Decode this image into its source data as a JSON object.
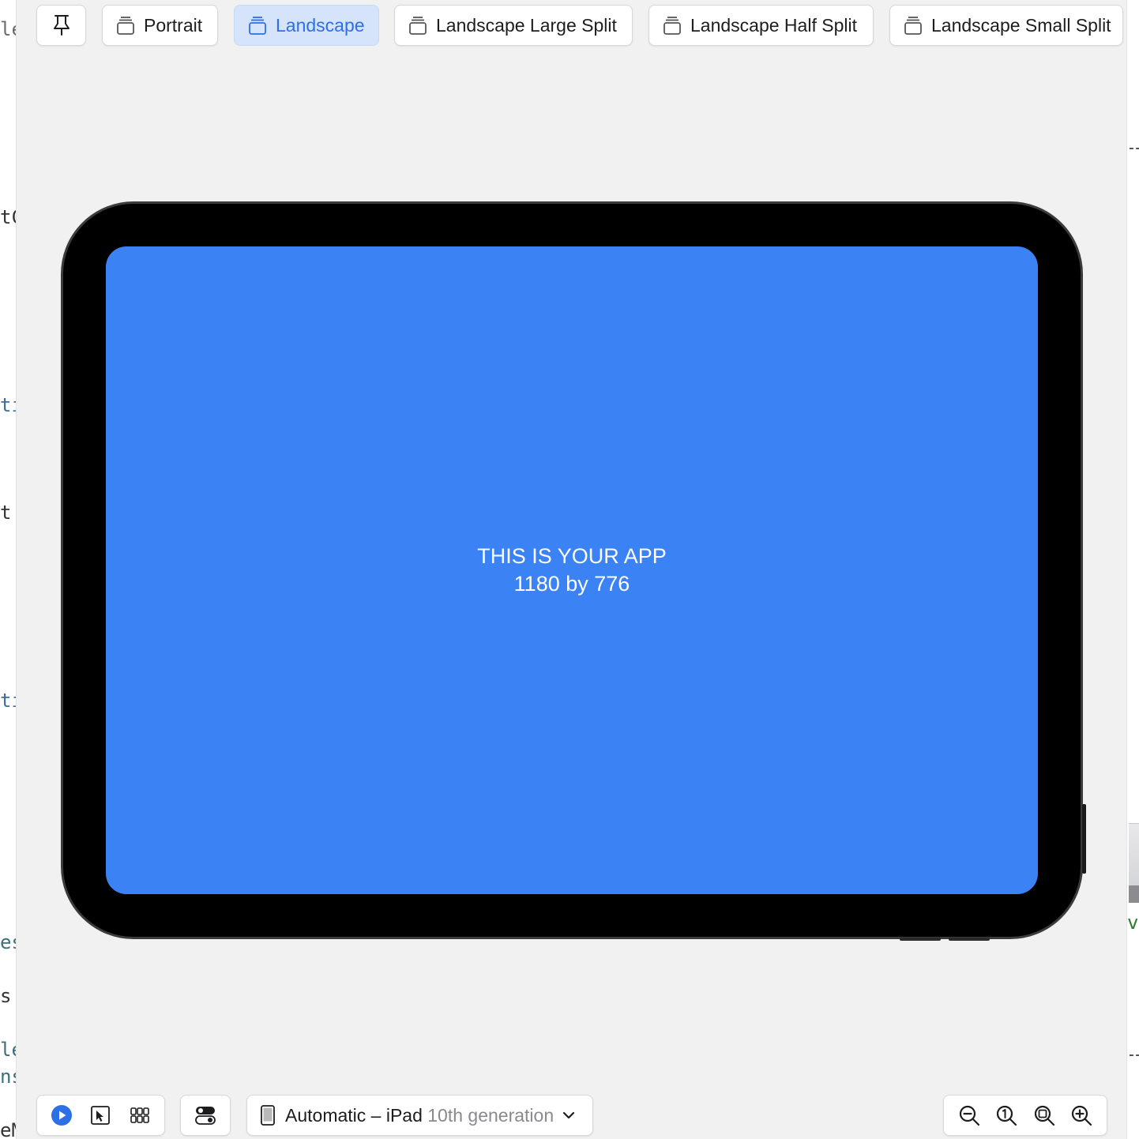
{
  "toolbar": {
    "pin_label": "",
    "orientations": [
      {
        "label": "Portrait",
        "selected": false
      },
      {
        "label": "Landscape",
        "selected": true
      },
      {
        "label": "Landscape Large Split",
        "selected": false
      },
      {
        "label": "Landscape Half Split",
        "selected": false
      },
      {
        "label": "Landscape Small Split",
        "selected": false
      }
    ]
  },
  "preview": {
    "line1": "THIS IS YOUR APP",
    "line2": "1180 by 776",
    "screen_color": "#3b82f5",
    "bezel_color": "#000000"
  },
  "device_selector": {
    "prefix": "Automatic – iPad",
    "model": "10th generation"
  },
  "bottom_controls": {
    "live_icon": "play-circle-icon",
    "select_icon": "cursor-select-icon",
    "variants_icon": "grid-variants-icon",
    "settings_icon": "toggle-settings-icon"
  },
  "zoom_controls": [
    "zoom-out-icon",
    "zoom-actual-size-icon",
    "zoom-to-fit-icon",
    "zoom-in-icon"
  ],
  "editor_fragments_left": [
    "le",
    "tC",
    "ti",
    "t",
    "ti",
    "es",
    "s",
    "le",
    "ns",
    "eM"
  ],
  "editor_fragments_right": [
    "ve"
  ],
  "colors": {
    "accent": "#2d6fe6",
    "selected_bg": "#d5e3fb",
    "canvas_bg": "#f1f1f1"
  }
}
